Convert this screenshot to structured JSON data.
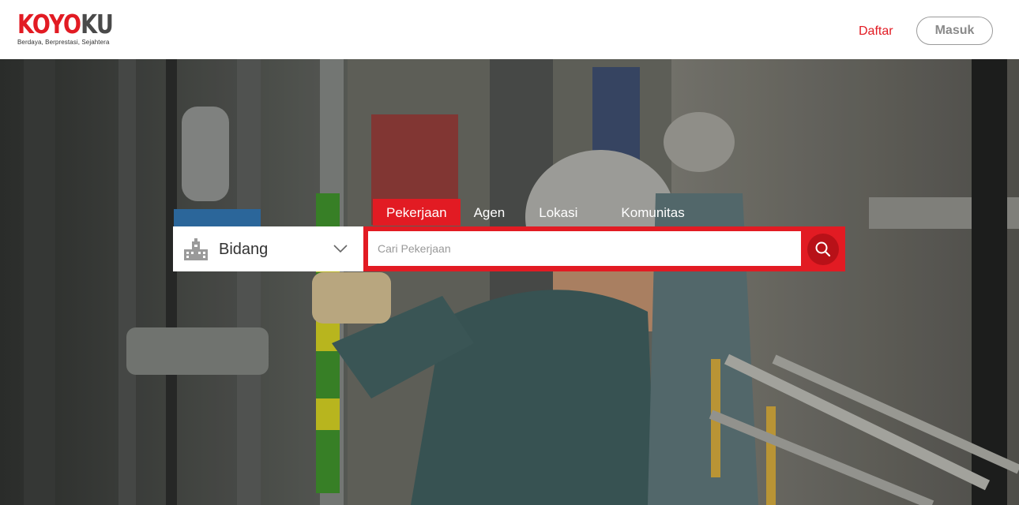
{
  "header": {
    "logo": {
      "part1": "KOYO",
      "part2": "KU",
      "tagline": "Berdaya, Berprestasi, Sejahtera"
    },
    "register_label": "Daftar",
    "login_label": "Masuk"
  },
  "hero": {
    "background_image": "industrial-worker-photo",
    "tabs": [
      {
        "label": "Pekerjaan",
        "active": true
      },
      {
        "label": "Agen",
        "active": false
      },
      {
        "label": "Lokasi",
        "active": false
      },
      {
        "label": "Komunitas",
        "active": false
      }
    ],
    "category_select": {
      "selected": "Bidang",
      "icon": "buildings-icon"
    },
    "search": {
      "placeholder": "Cari Pekerjaan",
      "value": "",
      "button_icon": "search-icon"
    }
  },
  "colors": {
    "brand_red": "#e21b23",
    "dark_red": "#b81118",
    "logo_grey": "#4a4a4a"
  }
}
